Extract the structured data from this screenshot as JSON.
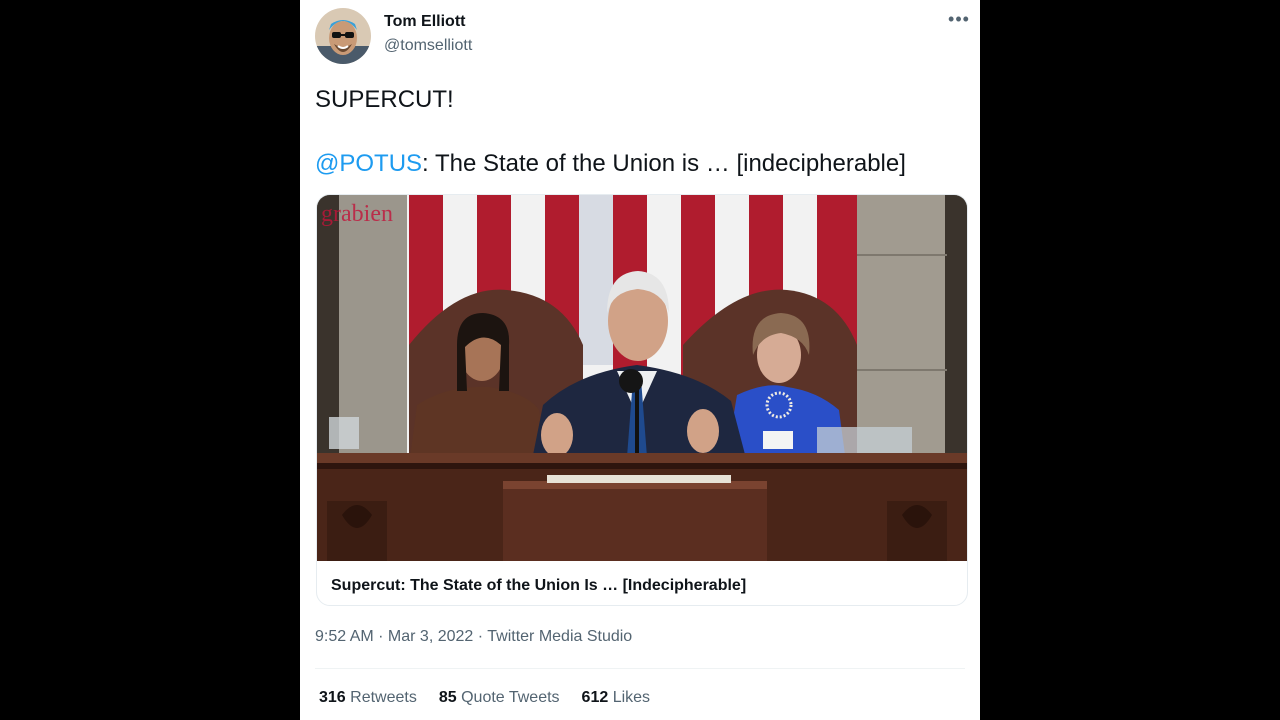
{
  "author": {
    "name": "Tom Elliott",
    "handle": "@tomselliott"
  },
  "tweet": {
    "line1": "SUPERCUT!",
    "mention": "@POTUS",
    "line2_rest": ": The State of the Union is … [indecipherable]"
  },
  "media": {
    "watermark": "grabien",
    "card_title": "Supercut: The State of the Union Is … [Indecipherable]"
  },
  "meta": {
    "time": "9:52 AM",
    "sep1": " · ",
    "date": "Mar 3, 2022",
    "sep2": " · ",
    "source": "Twitter Media Studio"
  },
  "stats": {
    "retweets_count": "316",
    "retweets_label": "Retweets",
    "quotes_count": "85",
    "quotes_label": "Quote Tweets",
    "likes_count": "612",
    "likes_label": "Likes"
  },
  "icons": {
    "more": "more-horizontal-icon"
  },
  "colors": {
    "link": "#1d9bf0",
    "secondary": "#536471",
    "primary": "#0f1419"
  }
}
